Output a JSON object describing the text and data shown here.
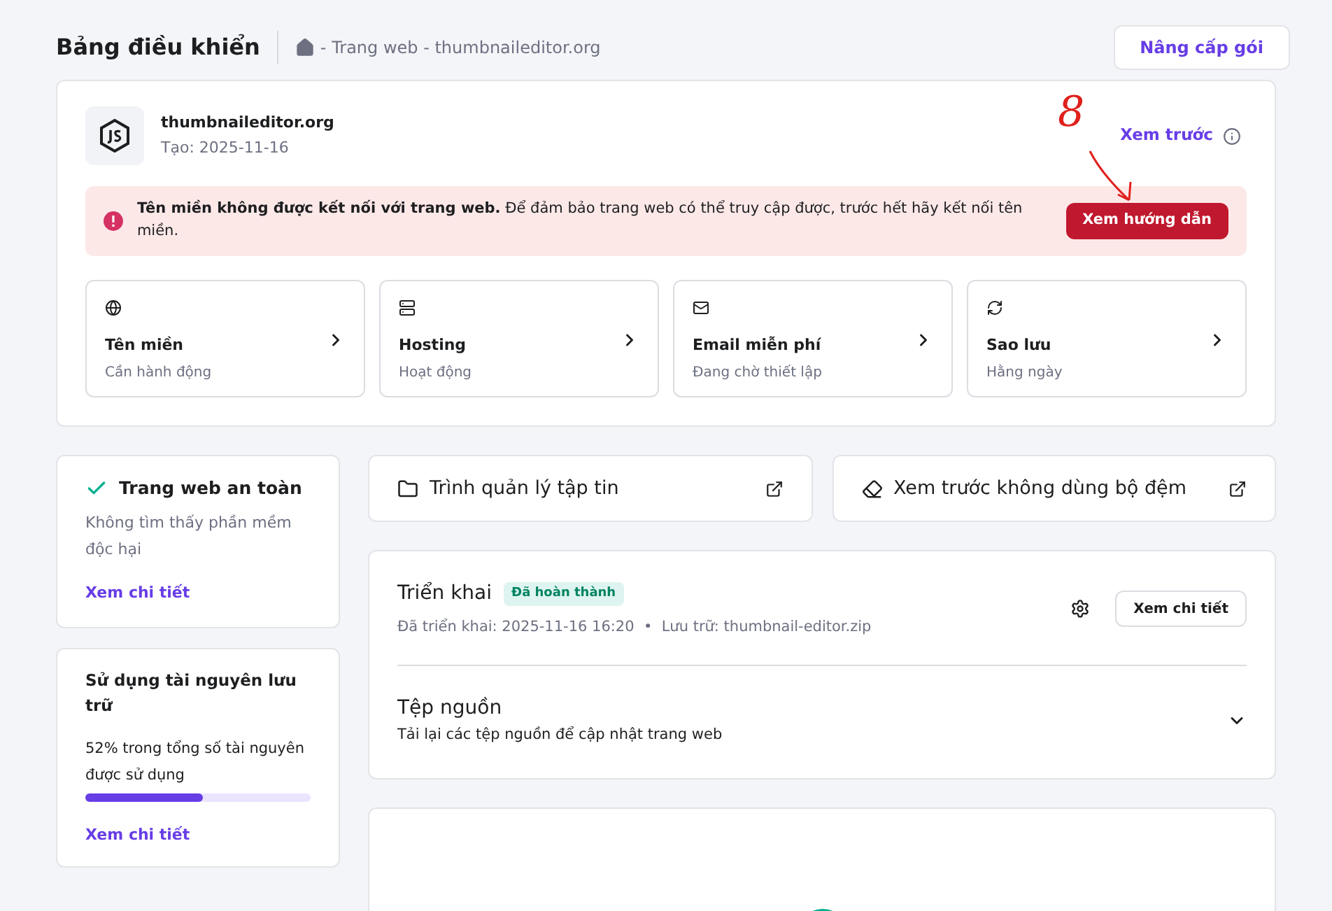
{
  "header": {
    "title": "Bảng điều khiển",
    "breadcrumb": "- Trang web - thumbnaileditor.org",
    "upgrade_button": "Nâng cấp gói"
  },
  "site": {
    "name": "thumbnaileditor.org",
    "created": "Tạo: 2025-11-16",
    "preview_link": "Xem trước"
  },
  "annotation": {
    "text": "8"
  },
  "alert": {
    "message": "**Tên miền không được kết nối với trang web.** Để đảm bảo trang web có thể truy cập được, trước hết hãy kết nối tên miền.",
    "button": "Xem hướng dẫn"
  },
  "tiles": [
    {
      "title": "Tên miền",
      "status": "Cần hành động"
    },
    {
      "title": "Hosting",
      "status": "Hoạt động"
    },
    {
      "title": "Email miễn phí",
      "status": "Đang chờ thiết lập"
    },
    {
      "title": "Sao lưu",
      "status": "Hằng ngày"
    }
  ],
  "security": {
    "title": "Trang web an toàn",
    "text": "Không tìm thấy phần mềm độc hại",
    "link": "Xem chi tiết"
  },
  "storage": {
    "title": "Sử dụng tài nguyên lưu trữ",
    "text": "52% trong tổng số tài nguyên được sử dụng",
    "level": 0.52,
    "link": "Xem chi tiết"
  },
  "shortcuts": [
    {
      "label": "Trình quản lý tập tin"
    },
    {
      "label": "Xem trước không dùng bộ đệm"
    }
  ],
  "deploy": {
    "title": "Triển khai",
    "badge": "Đã hoàn thành",
    "meta": "Đã triển khai: 2025-11-16 16:20  •  Lưu trữ: thumbnail-editor.zip",
    "button": "Xem chi tiết"
  },
  "source": {
    "title": "Tệp nguồn",
    "text": "Tải lại các tệp nguồn để cập nhật trang web",
    "expanded": false
  }
}
